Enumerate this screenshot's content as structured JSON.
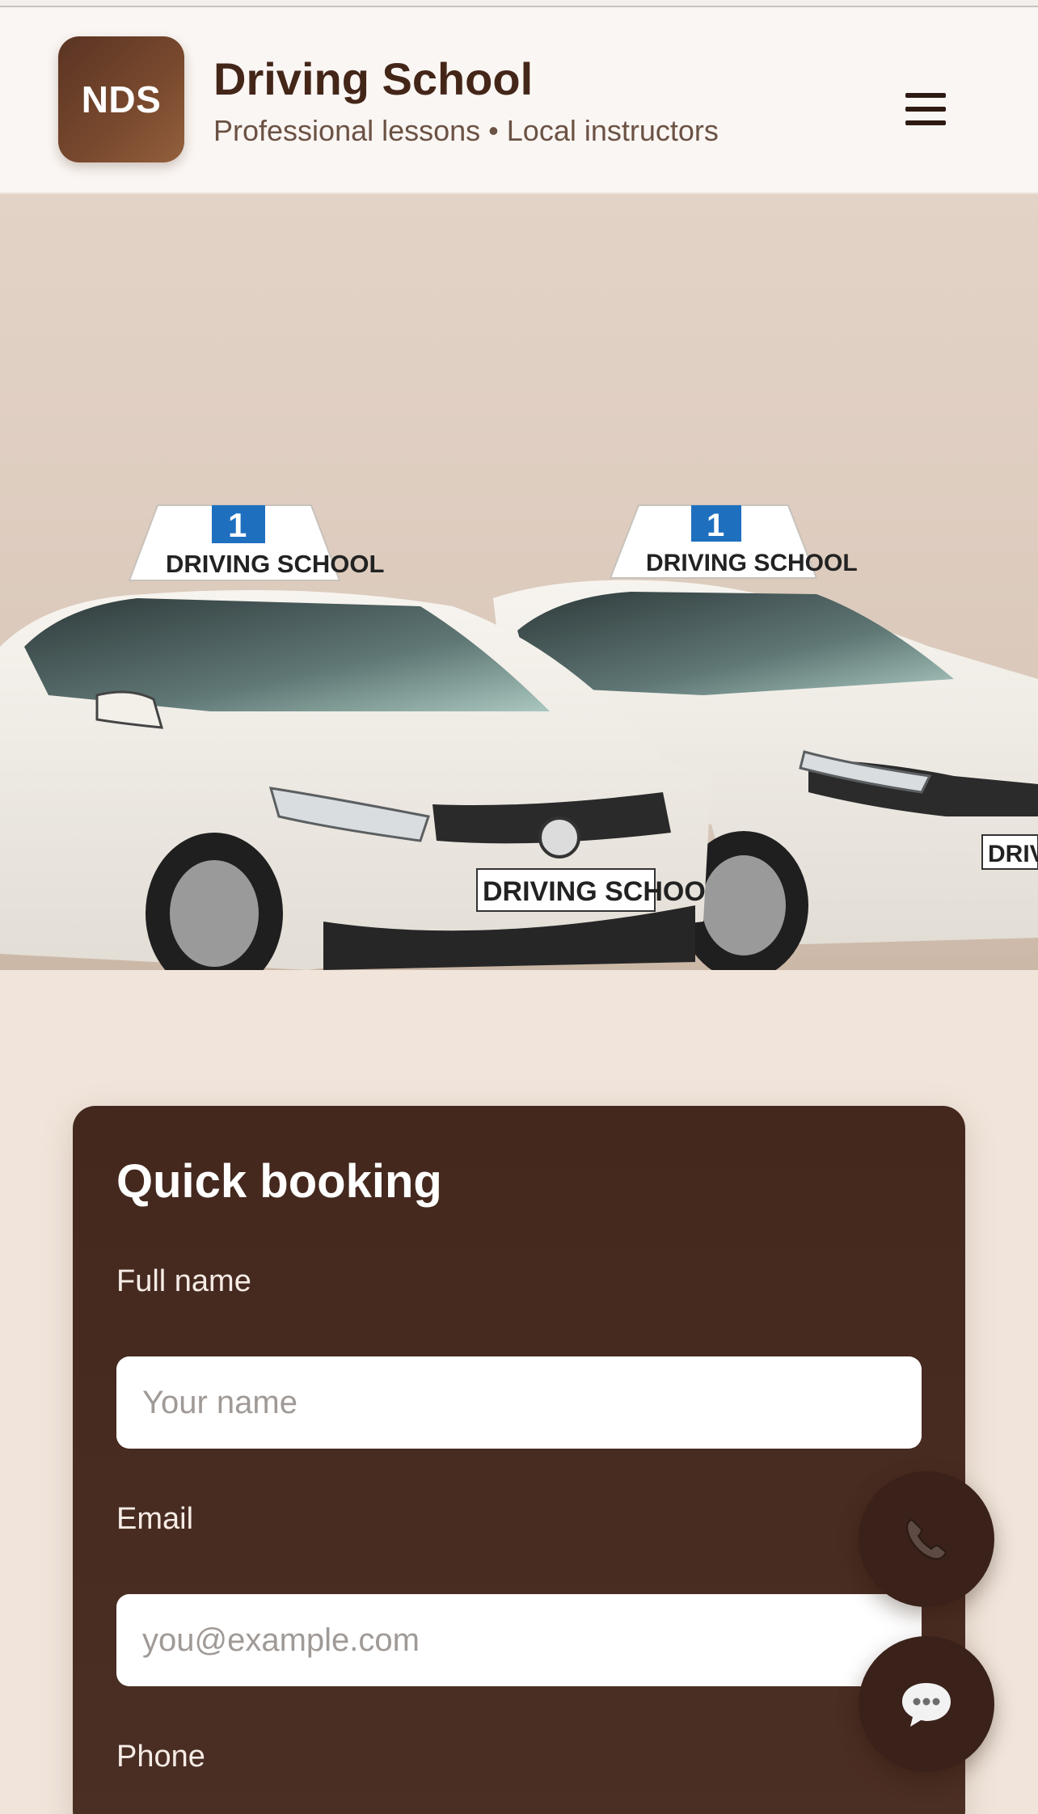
{
  "header": {
    "logo_text": "NDS",
    "title": "Driving School",
    "subtitle": "Professional lessons • Local instructors",
    "menu_icon": "hamburger-icon"
  },
  "hero": {
    "image": "two-white-driving-school-cars",
    "roof_sign_text": "DRIVING SCHOOL",
    "roof_sign_badge": "1",
    "plate_text_left": "DRIVING SCHOO",
    "plate_text_right": "DRIV"
  },
  "booking": {
    "title": "Quick booking",
    "fields": [
      {
        "label": "Full name",
        "placeholder": "Your name",
        "value": ""
      },
      {
        "label": "Email",
        "placeholder": "you@example.com",
        "value": ""
      },
      {
        "label": "Phone",
        "placeholder": "",
        "value": ""
      }
    ]
  },
  "floating": {
    "call_icon": "phone-icon",
    "chat_icon": "chat-bubble-icon"
  },
  "colors": {
    "brand_dark": "#44281e",
    "logo_brown": "#7a4a2e",
    "page_bg": "#f1e5db",
    "header_bg": "#faf6f3"
  }
}
